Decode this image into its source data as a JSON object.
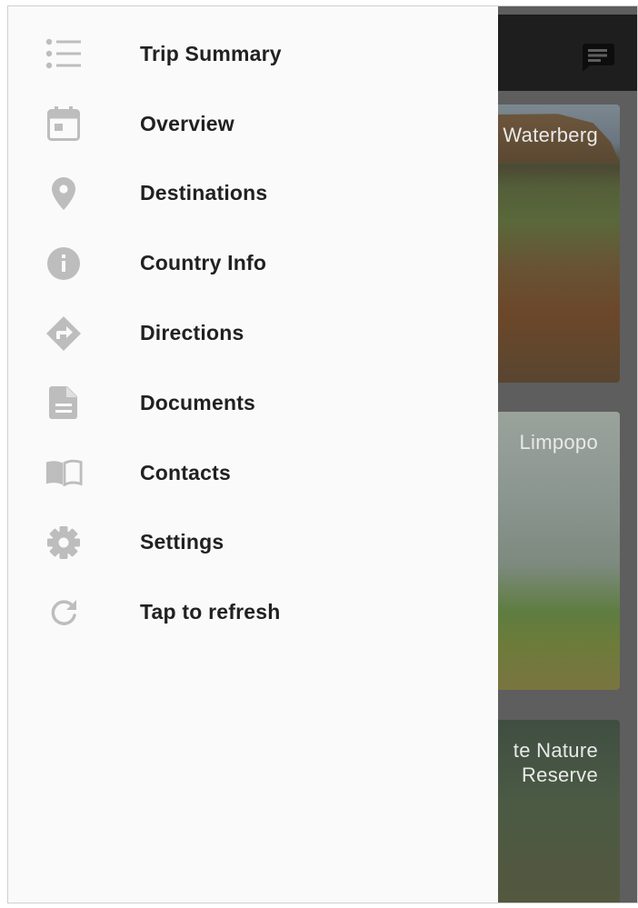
{
  "colors": {
    "drawer_bg": "#fafafa",
    "icon": "#bdbdbd",
    "label": "#212121",
    "app_bar": "#1e1e1e"
  },
  "drawer": {
    "items": [
      {
        "label": "Trip Summary",
        "icon": "list-icon"
      },
      {
        "label": "Overview",
        "icon": "calendar-icon"
      },
      {
        "label": "Destinations",
        "icon": "location-pin-icon"
      },
      {
        "label": "Country Info",
        "icon": "info-icon"
      },
      {
        "label": "Directions",
        "icon": "directions-icon"
      },
      {
        "label": "Documents",
        "icon": "document-icon"
      },
      {
        "label": "Contacts",
        "icon": "book-icon"
      },
      {
        "label": "Settings",
        "icon": "gear-icon"
      },
      {
        "label": "Tap to refresh",
        "icon": "refresh-icon"
      }
    ]
  },
  "background": {
    "app_bar_action_icon": "chat-icon",
    "cards": [
      {
        "title": "Waterberg"
      },
      {
        "title": "Limpopo"
      },
      {
        "title": "te Nature\nReserve"
      }
    ]
  }
}
